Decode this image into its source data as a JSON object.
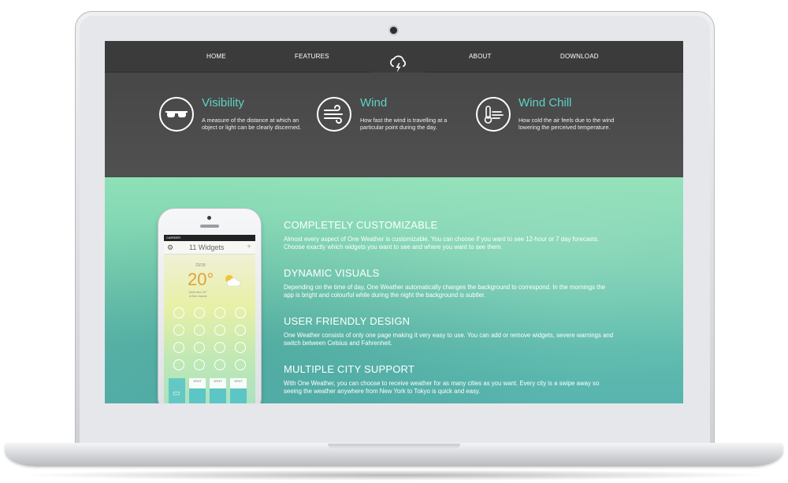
{
  "nav": {
    "items": [
      "HOME",
      "FEATURES",
      "ABOUT",
      "DOWNLOAD"
    ]
  },
  "features": [
    {
      "icon": "sunglasses-icon",
      "title": "Visibility",
      "description": "A measure of the distance at which an object or light can be clearly discerned."
    },
    {
      "icon": "wind-icon",
      "title": "Wind",
      "description": "How fast the wind is travelling at a particular point during the day."
    },
    {
      "icon": "thermometer-wind-icon",
      "title": "Wind Chill",
      "description": "How cold the air feels due to the wind lowering the perceived temperature."
    }
  ],
  "sections": [
    {
      "title": "COMPLETELY CUSTOMIZABLE",
      "text": "Almost every aspect of One Weather is customizable. You can choose if you want to see 12-hour or 7 day forecasts. Choose exactly which widgets you want to see and where you want to see them."
    },
    {
      "title": "DYNAMIC VISUALS",
      "text": "Depending on the time of day, One Weather automatically changes the background to correspond. In the mornings the app is bright and colourful while during the night the background is subtler."
    },
    {
      "title": "USER FRIENDLY DESIGN",
      "text": "One Weather consists of only one page making it very easy to use. You can add or remove widgets, severe warnings and switch between Celsius and Fahrenheit."
    },
    {
      "title": "MULTIPLE CITY SUPPORT",
      "text": "With One Weather, you can choose to receive weather for as many cities as you want. Every city is a swipe away so seeing the weather anywhere from New York to Tokyo is quick and easy."
    }
  ],
  "phone": {
    "carrier": "CARRIER",
    "widgets_title": "11 Widgets",
    "date": "23/18",
    "temperature": "20°",
    "feels_like": "feels like 22°",
    "condition": "A few clouds",
    "cards": [
      "07/17",
      "07/17",
      "07/17"
    ]
  },
  "colors": {
    "accent": "#5fd3c6",
    "nav_bg": "#3b3b3b",
    "features_bg": "#4b4b4b",
    "hero_top": "#8fe0b7",
    "hero_bottom": "#58b4ae"
  }
}
